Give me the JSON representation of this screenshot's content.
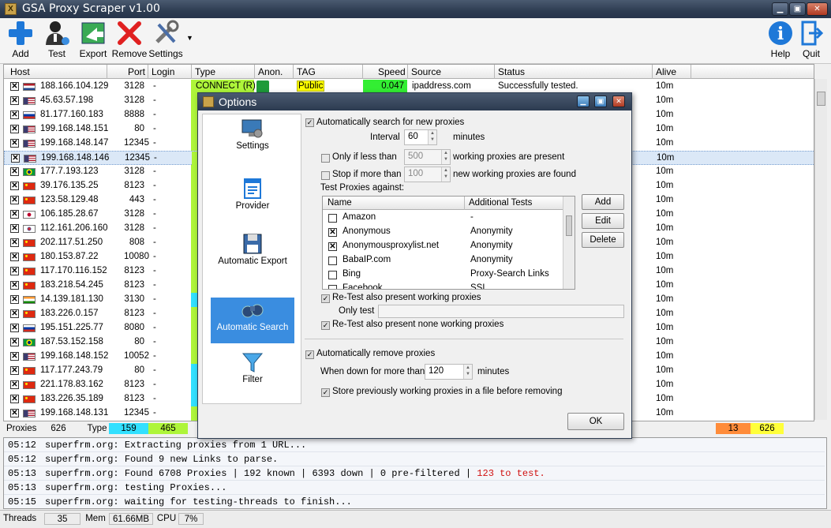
{
  "window": {
    "title": "GSA Proxy Scraper v1.00"
  },
  "toolbar": {
    "add": "Add",
    "test": "Test",
    "export": "Export",
    "remove": "Remove",
    "settings": "Settings",
    "help": "Help",
    "quit": "Quit"
  },
  "grid": {
    "columns": [
      "Host",
      "Port",
      "Login",
      "Type",
      "Anon.",
      "TAG",
      "Speed",
      "Source",
      "Status",
      "Alive"
    ],
    "rows": [
      {
        "host": "188.166.104.129",
        "port": "3128",
        "login": "-",
        "flag": "nl",
        "type": "CONNECT (R)",
        "tag": "Public",
        "speed": "0.047",
        "source": "ipaddress.com",
        "status": "Successfully tested.",
        "alive": "10m"
      },
      {
        "host": "45.63.57.198",
        "port": "3128",
        "login": "-",
        "flag": "us",
        "alive": "10m"
      },
      {
        "host": "81.177.160.183",
        "port": "8888",
        "login": "-",
        "flag": "ru",
        "alive": "10m"
      },
      {
        "host": "199.168.148.151",
        "port": "80",
        "login": "-",
        "flag": "us",
        "alive": "10m"
      },
      {
        "host": "199.168.148.147",
        "port": "12345",
        "login": "-",
        "flag": "us",
        "alive": "10m"
      },
      {
        "host": "199.168.148.146",
        "port": "12345",
        "login": "-",
        "flag": "us",
        "alive": "10m",
        "selected": true
      },
      {
        "host": "177.7.193.123",
        "port": "3128",
        "login": "-",
        "flag": "br",
        "alive": "10m"
      },
      {
        "host": "39.176.135.25",
        "port": "8123",
        "login": "-",
        "flag": "cn",
        "alive": "10m"
      },
      {
        "host": "123.58.129.48",
        "port": "443",
        "login": "-",
        "flag": "cn",
        "alive": "10m"
      },
      {
        "host": "106.185.28.67",
        "port": "3128",
        "login": "-",
        "flag": "jp",
        "alive": "10m"
      },
      {
        "host": "112.161.206.160",
        "port": "3128",
        "login": "-",
        "flag": "kr",
        "alive": "10m"
      },
      {
        "host": "202.117.51.250",
        "port": "808",
        "login": "-",
        "flag": "cn",
        "alive": "10m"
      },
      {
        "host": "180.153.87.22",
        "port": "10080",
        "login": "-",
        "flag": "cn",
        "alive": "10m"
      },
      {
        "host": "117.170.116.152",
        "port": "8123",
        "login": "-",
        "flag": "cn",
        "alive": "10m"
      },
      {
        "host": "183.218.54.245",
        "port": "8123",
        "login": "-",
        "flag": "cn",
        "alive": "10m"
      },
      {
        "host": "14.139.181.130",
        "port": "3130",
        "login": "-",
        "flag": "in",
        "alive": "10m"
      },
      {
        "host": "183.226.0.157",
        "port": "8123",
        "login": "-",
        "flag": "cn",
        "alive": "10m"
      },
      {
        "host": "195.151.225.77",
        "port": "8080",
        "login": "-",
        "flag": "ru",
        "alive": "10m"
      },
      {
        "host": "187.53.152.158",
        "port": "80",
        "login": "-",
        "flag": "br",
        "alive": "10m"
      },
      {
        "host": "199.168.148.152",
        "port": "10052",
        "login": "-",
        "flag": "us",
        "alive": "10m"
      },
      {
        "host": "117.177.243.79",
        "port": "80",
        "login": "-",
        "flag": "cn",
        "alive": "10m"
      },
      {
        "host": "221.178.83.162",
        "port": "8123",
        "login": "-",
        "flag": "cn",
        "alive": "10m"
      },
      {
        "host": "183.226.35.189",
        "port": "8123",
        "login": "-",
        "flag": "cn",
        "alive": "10m"
      },
      {
        "host": "199.168.148.131",
        "port": "12345",
        "login": "-",
        "flag": "us",
        "alive": "10m"
      }
    ],
    "type_colors": [
      "#aef53a",
      "#aef53a",
      "#aef53a",
      "#aef53a",
      "#aef53a",
      "#aef53a",
      "#aef53a",
      "#aef53a",
      "#aef53a",
      "#aef53a",
      "#aef53a",
      "#aef53a",
      "#aef53a",
      "#aef53a",
      "#aef53a",
      "#32e0ff",
      "#aef53a",
      "#aef53a",
      "#aef53a",
      "#aef53a",
      "#32e0ff",
      "#32e0ff",
      "#32e0ff",
      "#aef53a"
    ]
  },
  "summary": {
    "proxies_label": "Proxies",
    "proxies": "626",
    "type_label": "Type",
    "type_a": "159",
    "type_b": "465",
    "right_a": "13",
    "right_b": "626"
  },
  "log": [
    {
      "time": "05:12",
      "msg": "superfrm.org: Extracting proxies from 1 URL..."
    },
    {
      "time": "05:12",
      "msg": "superfrm.org: Found 9 new Links to parse."
    },
    {
      "time": "05:13",
      "msg": "superfrm.org: Found 6708 Proxies | 192 known | 6393 down | 0 pre-filtered | ",
      "red": "123 to test."
    },
    {
      "time": "05:13",
      "msg": "superfrm.org: testing Proxies..."
    },
    {
      "time": "05:15",
      "msg": "superfrm.org: waiting for testing-threads to finish..."
    }
  ],
  "bottom": {
    "threads_label": "Threads",
    "threads": "35",
    "mem_label": "Mem",
    "mem": "61.66MB",
    "cpu_label": "CPU",
    "cpu": "7%"
  },
  "dialog": {
    "title": "Options",
    "sidebar": [
      "Settings",
      "Provider",
      "Automatic Export",
      "Automatic Search",
      "Filter"
    ],
    "auto_search": "Automatically search for new proxies",
    "interval_label": "Interval",
    "interval": "60",
    "minutes": "minutes",
    "only_if_less": "Only if less than",
    "only_if_less_val": "500",
    "working_present": "working proxies are present",
    "stop_if_more": "Stop if more than",
    "stop_if_more_val": "100",
    "new_found": "new working proxies are found",
    "test_against": "Test Proxies against:",
    "list_cols": [
      "Name",
      "Additional Tests"
    ],
    "list_rows": [
      {
        "name": "Amazon",
        "tests": "-",
        "checked": false
      },
      {
        "name": "Anonymous",
        "tests": "Anonymity",
        "checked": true
      },
      {
        "name": "Anonymousproxylist.net",
        "tests": "Anonymity",
        "checked": true
      },
      {
        "name": "BabaIP.com",
        "tests": "Anonymity",
        "checked": false
      },
      {
        "name": "Bing",
        "tests": "Proxy-Search Links",
        "checked": false
      },
      {
        "name": "Facebook",
        "tests": "SSL",
        "checked": false
      }
    ],
    "add": "Add",
    "edit": "Edit",
    "delete": "Delete",
    "retest_working": "Re-Test also present working proxies",
    "only_test": "Only test",
    "retest_none": "Re-Test also present none working proxies",
    "auto_remove": "Automatically remove proxies",
    "when_down": "When down for more than",
    "when_down_val": "120",
    "minutes2": "minutes",
    "store_prev": "Store previously working proxies in a file before removing",
    "ok": "OK"
  },
  "colors": {
    "title_bar": "#2e3d52",
    "type_green": "#aef53a",
    "type_cyan": "#32e0ff",
    "tag_yellow": "#ffff00",
    "speed_green": "#33ee33",
    "accent_blue": "#3a8de0"
  }
}
